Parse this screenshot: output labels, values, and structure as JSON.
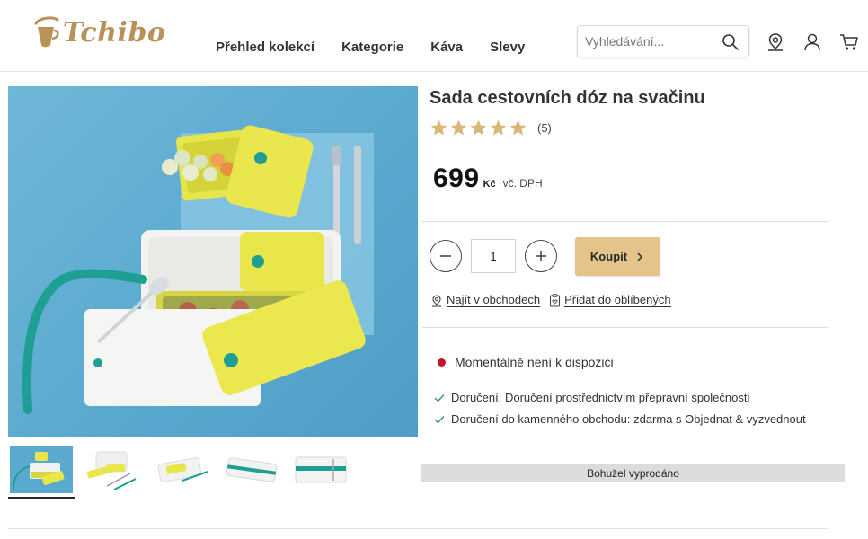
{
  "brand": {
    "name": "Tchibo",
    "color": "#b9925a"
  },
  "nav": {
    "items": [
      "Přehled kolekcí",
      "Kategorie",
      "Káva",
      "Slevy"
    ]
  },
  "search": {
    "placeholder": "Vyhledávání..."
  },
  "header_icons": [
    "store-locator-icon",
    "account-icon",
    "cart-icon"
  ],
  "product": {
    "title": "Sada cestovních dóz na svačinu",
    "rating": {
      "stars": 5,
      "max": 5,
      "count": "(5)"
    },
    "price": {
      "value": "699",
      "currency": "Kč",
      "vat_note": "vč. DPH"
    },
    "quantity": "1",
    "buy_label": "Koupit",
    "links": {
      "find_in_store": "Najít v obchodech",
      "add_to_favorites": "Přidat do oblíbených"
    },
    "availability": {
      "text": "Momentálně není k dispozici",
      "color": "#c8102e"
    },
    "delivery": [
      "Doručení: Doručení prostřednictvím přepravní společnosti",
      "Doručení do kamenného obchodu: zdarma s Objednat & vyzvednout"
    ],
    "sold_out": "Bohužel vyprodáno"
  },
  "gallery": {
    "thumbnail_count": 5,
    "active_index": 0
  },
  "colors": {
    "accent": "#e4c48a",
    "image_bg": "#5aa9cf",
    "lunchbox": "#e6e64a",
    "teal": "#1f9e93"
  }
}
